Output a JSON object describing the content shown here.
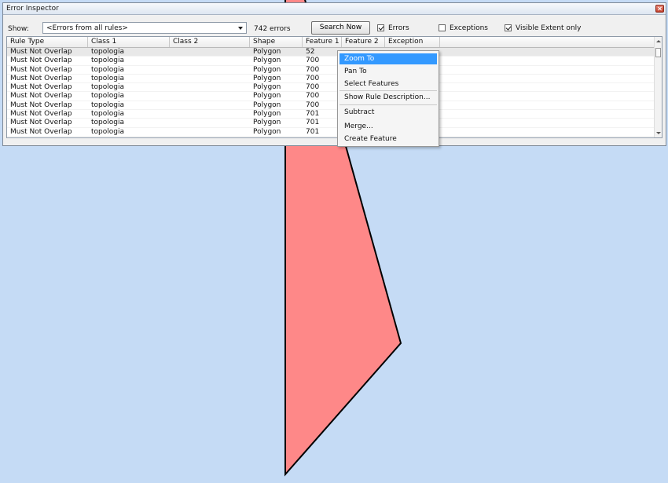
{
  "map": {
    "background": "#c5dbf5",
    "feature_fill": "#fe8888",
    "feature_outline": "#000000"
  },
  "inspector": {
    "title": "Error Inspector",
    "close_icon": "close-icon",
    "show_label": "Show:",
    "rules_filter": "<Errors from all rules>",
    "error_count": "742 errors",
    "search_button": "Search Now",
    "errors_checkbox": {
      "label": "Errors",
      "checked": true
    },
    "exceptions_checkbox": {
      "label": "Exceptions",
      "checked": false
    },
    "visible_extent_checkbox": {
      "label": "Visible Extent only",
      "checked": true
    }
  },
  "grid": {
    "columns": [
      "Rule Type",
      "Class 1",
      "Class 2",
      "Shape",
      "Feature 1",
      "Feature 2",
      "Exception"
    ],
    "rows": [
      [
        "Must Not Overlap",
        "topologia",
        "",
        "Polygon",
        "52",
        "",
        ""
      ],
      [
        "Must Not Overlap",
        "topologia",
        "",
        "Polygon",
        "700",
        "",
        ""
      ],
      [
        "Must Not Overlap",
        "topologia",
        "",
        "Polygon",
        "700",
        "",
        ""
      ],
      [
        "Must Not Overlap",
        "topologia",
        "",
        "Polygon",
        "700",
        "",
        ""
      ],
      [
        "Must Not Overlap",
        "topologia",
        "",
        "Polygon",
        "700",
        "",
        ""
      ],
      [
        "Must Not Overlap",
        "topologia",
        "",
        "Polygon",
        "700",
        "",
        ""
      ],
      [
        "Must Not Overlap",
        "topologia",
        "",
        "Polygon",
        "700",
        "",
        ""
      ],
      [
        "Must Not Overlap",
        "topologia",
        "",
        "Polygon",
        "701",
        "",
        ""
      ],
      [
        "Must Not Overlap",
        "topologia",
        "",
        "Polygon",
        "701",
        "",
        ""
      ],
      [
        "Must Not Overlap",
        "topologia",
        "",
        "Polygon",
        "701",
        "",
        ""
      ]
    ]
  },
  "context_menu": {
    "items": [
      "Zoom To",
      "Pan To",
      "Select Features",
      "Show Rule Description...",
      "Subtract",
      "Merge...",
      "Create Feature"
    ]
  }
}
